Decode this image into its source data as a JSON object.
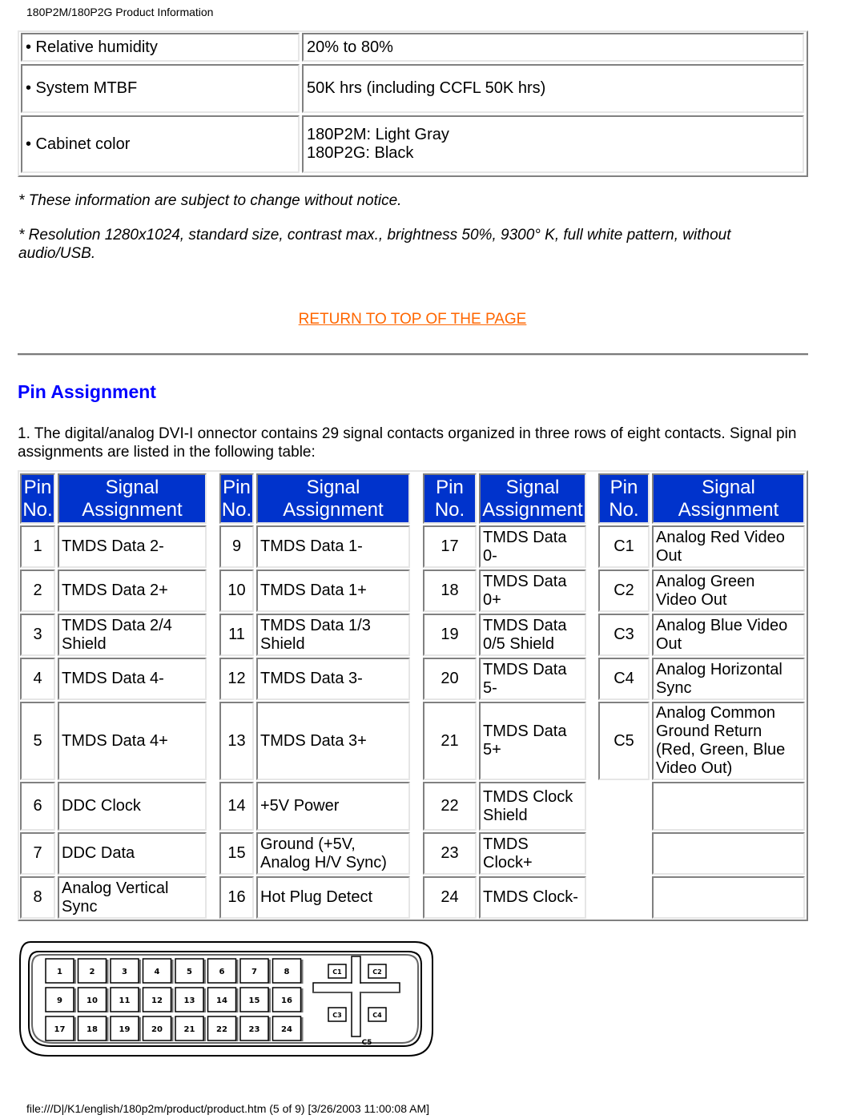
{
  "page_header": "180P2M/180P2G Product Information",
  "spec_table": {
    "rows": [
      {
        "label": "• Relative humidity",
        "value": "20% to 80%"
      },
      {
        "label": "• System MTBF",
        "value": "50K hrs (including CCFL 50K hrs)"
      },
      {
        "label": "• Cabinet color",
        "value": "180P2M: Light Gray\n180P2G: Black"
      }
    ]
  },
  "notes": [
    "* These information are subject to change without notice.",
    "* Resolution 1280x1024, standard size, contrast max., brightness 50%, 9300° K, full white pattern, without audio/USB."
  ],
  "return_link": "RETURN TO TOP OF THE PAGE",
  "section_title": "Pin Assignment",
  "intro_text": "1. The digital/analog DVI-I onnector contains 29 signal contacts organized in three rows of eight contacts. Signal pin assignments are listed in the following table:",
  "pin_table": {
    "header": {
      "pin": "Pin\nNo.",
      "signal": "Signal\nAssignment"
    },
    "groups": [
      {
        "rows": [
          {
            "pin": "1",
            "signal": "TMDS Data 2-"
          },
          {
            "pin": "2",
            "signal": "TMDS Data 2+"
          },
          {
            "pin": "3",
            "signal": "TMDS Data 2/4\nShield"
          },
          {
            "pin": "4",
            "signal": "TMDS Data 4-"
          },
          {
            "pin": "5",
            "signal": "TMDS Data 4+"
          },
          {
            "pin": "6",
            "signal": "DDC Clock"
          },
          {
            "pin": "7",
            "signal": "DDC Data"
          },
          {
            "pin": "8",
            "signal": "Analog Vertical\nSync"
          }
        ]
      },
      {
        "rows": [
          {
            "pin": "9",
            "signal": "TMDS Data 1-"
          },
          {
            "pin": "10",
            "signal": "TMDS Data 1+"
          },
          {
            "pin": "11",
            "signal": "TMDS Data 1/3\nShield"
          },
          {
            "pin": "12",
            "signal": "TMDS Data 3-"
          },
          {
            "pin": "13",
            "signal": "TMDS Data 3+"
          },
          {
            "pin": "14",
            "signal": "+5V Power"
          },
          {
            "pin": "15",
            "signal": "Ground (+5V,\nAnalog H/V Sync)"
          },
          {
            "pin": "16",
            "signal": "Hot Plug Detect"
          }
        ]
      },
      {
        "rows": [
          {
            "pin": "17",
            "signal": "TMDS Data\n0-"
          },
          {
            "pin": "18",
            "signal": "TMDS Data\n0+"
          },
          {
            "pin": "19",
            "signal": "TMDS Data\n0/5 Shield"
          },
          {
            "pin": "20",
            "signal": "TMDS Data\n5-"
          },
          {
            "pin": "21",
            "signal": "TMDS Data\n5+"
          },
          {
            "pin": "22",
            "signal": "TMDS Clock\nShield"
          },
          {
            "pin": "23",
            "signal": "TMDS\nClock+"
          },
          {
            "pin": "24",
            "signal": "TMDS Clock-"
          }
        ]
      },
      {
        "rows": [
          {
            "pin": "C1",
            "signal": "Analog Red Video\nOut"
          },
          {
            "pin": "C2",
            "signal": "Analog Green\nVideo Out"
          },
          {
            "pin": "C3",
            "signal": "Analog Blue Video\nOut"
          },
          {
            "pin": "C4",
            "signal": "Analog Horizontal\nSync"
          },
          {
            "pin": "C5",
            "signal": "Analog Common\nGround Return\n(Red, Green, Blue\nVideo Out)"
          },
          {
            "pin": "",
            "signal": ""
          },
          {
            "pin": "",
            "signal": ""
          },
          {
            "pin": "",
            "signal": ""
          }
        ]
      }
    ]
  },
  "connector_diagram": {
    "digital_pins": [
      "1",
      "2",
      "3",
      "4",
      "5",
      "6",
      "7",
      "8",
      "9",
      "10",
      "11",
      "12",
      "13",
      "14",
      "15",
      "16",
      "17",
      "18",
      "19",
      "20",
      "21",
      "22",
      "23",
      "24"
    ],
    "analog_pins": [
      "C1",
      "C2",
      "C3",
      "C4",
      "C5"
    ]
  },
  "footer": "file:///D|/K1/english/180p2m/product/product.htm (5 of 9) [3/26/2003 11:00:08 AM]",
  "colors": {
    "header_bg": "#0033cc",
    "header_text": "#ffffff",
    "link": "#ff6600",
    "section_title": "#0000ff"
  }
}
